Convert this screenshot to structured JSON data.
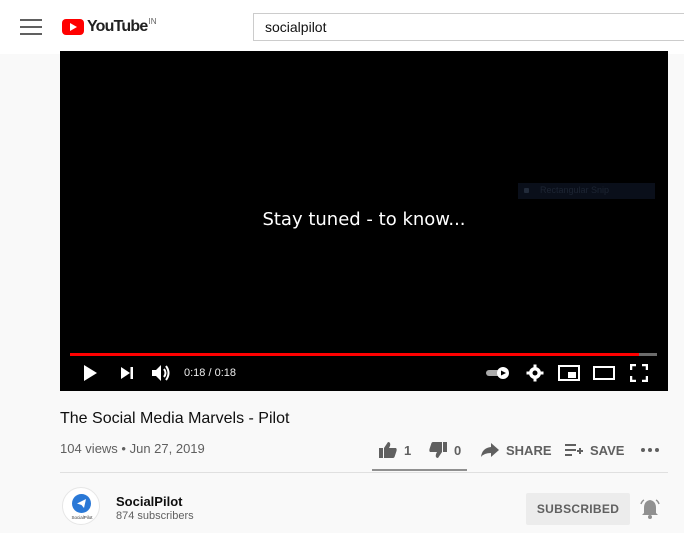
{
  "header": {
    "logo_text": "YouTube",
    "region": "IN",
    "search_value": "socialpilot"
  },
  "player": {
    "caption": "Stay tuned - to know...",
    "overlay_text": "Rectangular Snip",
    "time_display": "0:18 / 0:18",
    "progress": 0.97
  },
  "video": {
    "title": "The Social Media Marvels - Pilot",
    "meta": "104 views • Jun 27, 2019"
  },
  "actions": {
    "likes": "1",
    "dislikes": "0",
    "share": "SHARE",
    "save": "SAVE"
  },
  "channel": {
    "avatar_label": "SocialPilot",
    "name": "SocialPilot",
    "subscribers": "874 subscribers",
    "subscribe_label": "SUBSCRIBED"
  },
  "colors": {
    "brand_red": "#ff0000",
    "avatar_blue": "#2a78d6"
  }
}
